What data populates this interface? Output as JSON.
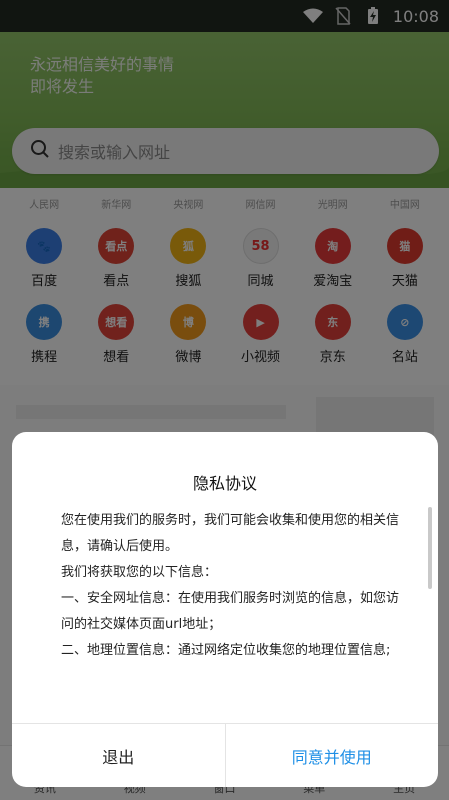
{
  "status_bar": {
    "time": "10:08",
    "icons": [
      "wifi-icon",
      "no-sim-icon",
      "battery-charging-icon"
    ]
  },
  "header": {
    "slogan_line1": "永远相信美好的事情",
    "slogan_line2": "即将发生",
    "search_placeholder": "搜索或输入网址"
  },
  "news_sites": [
    "人民网",
    "新华网",
    "央视网",
    "网信网",
    "光明网",
    "中国网"
  ],
  "apps": [
    {
      "label": "百度",
      "icon": "baidu-paw-icon",
      "color": "#3b7ee6",
      "glyph": "🐾"
    },
    {
      "label": "看点",
      "icon": "kandian-icon",
      "color": "#e04436",
      "glyph": "看点"
    },
    {
      "label": "搜狐",
      "icon": "sohu-icon",
      "color": "#f2b414",
      "glyph": "狐"
    },
    {
      "label": "同城",
      "icon": "58-tongcheng-icon",
      "color": "#f3f3f3",
      "glyph": "58"
    },
    {
      "label": "爱淘宝",
      "icon": "taobao-icon",
      "color": "#e83b3b",
      "glyph": "淘"
    },
    {
      "label": "天猫",
      "icon": "tmall-icon",
      "color": "#e13a2f",
      "glyph": "猫"
    },
    {
      "label": "携程",
      "icon": "ctrip-icon",
      "color": "#3a8ee0",
      "glyph": "携"
    },
    {
      "label": "想看",
      "icon": "xiangkan-icon",
      "color": "#e2453a",
      "glyph": "想看"
    },
    {
      "label": "微博",
      "icon": "weibo-icon",
      "color": "#f39a1c",
      "glyph": "博"
    },
    {
      "label": "小视频",
      "icon": "play-icon",
      "color": "#e6403c",
      "glyph": "▶"
    },
    {
      "label": "京东",
      "icon": "jd-icon",
      "color": "#e3403a",
      "glyph": "东"
    },
    {
      "label": "名站",
      "icon": "compass-icon",
      "color": "#3a90e6",
      "glyph": "⊘"
    }
  ],
  "bottom_nav": [
    "资讯",
    "视频",
    "窗口",
    "菜单",
    "主页"
  ],
  "dialog": {
    "title": "隐私协议",
    "paragraphs": [
      "您在使用我们的服务时，我们可能会收集和使用您的相关信息，请确认后使用。",
      "我们将获取您的以下信息：",
      "一、安全网址信息：在使用我们服务时浏览的信息，如您访问的社交媒体页面url地址；",
      "二、地理位置信息：通过网络定位收集您的地理位置信息;"
    ],
    "exit_label": "退出",
    "agree_label": "同意并使用"
  },
  "colors": {
    "accent": "#1e8fe6",
    "header_green": "#82b957",
    "status_bar": "#232a22"
  }
}
